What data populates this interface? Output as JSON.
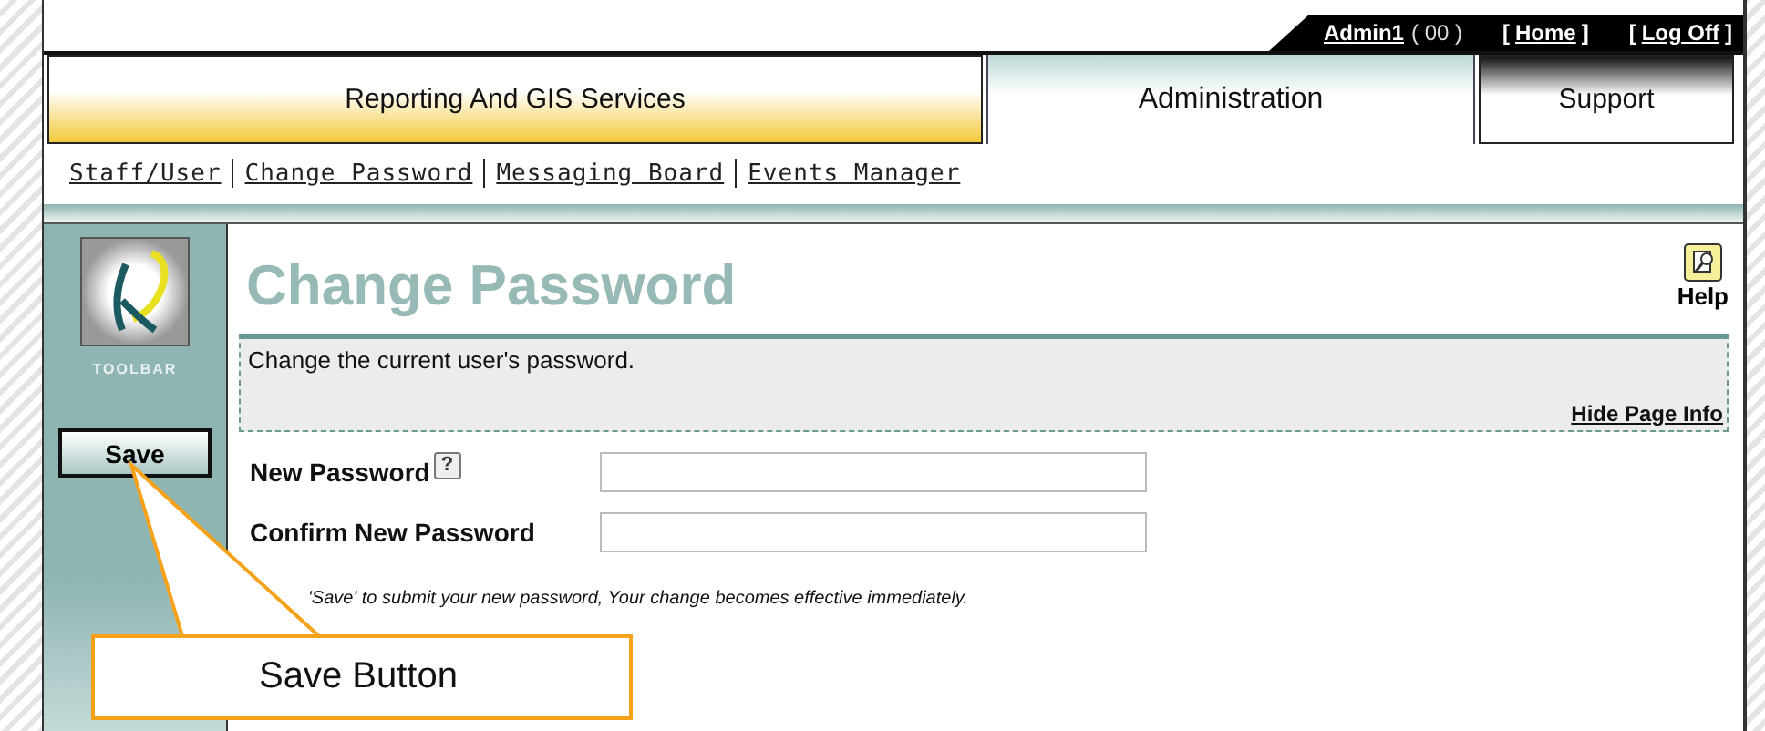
{
  "user_bar": {
    "user": "Admin1",
    "count": "( 00 )",
    "links": [
      {
        "open": "[",
        "label": "Home",
        "close": "]"
      },
      {
        "open": "[",
        "label": "Log Off",
        "close": "]"
      }
    ]
  },
  "tabs": [
    {
      "label": "Reporting And GIS Services",
      "kind": "gold",
      "selected": false
    },
    {
      "label": "Administration",
      "kind": "plain",
      "selected": true
    },
    {
      "label": "Support",
      "kind": "dark",
      "selected": false
    }
  ],
  "subnav": [
    "Staff/User",
    "Change Password",
    "Messaging Board",
    "Events Manager"
  ],
  "toolbar": {
    "caption": "TOOLBAR",
    "buttons": [
      "Save"
    ]
  },
  "page": {
    "title": "Change Password",
    "help": "Help",
    "info": "Change the current user's password.",
    "hide_info": "Hide Page Info",
    "fields": [
      {
        "label": "New Password",
        "help_mark": "?"
      },
      {
        "label": "Confirm New Password"
      }
    ],
    "note": "'Save' to submit your new password, Your change becomes effective immediately."
  },
  "callout": {
    "text": "Save Button"
  }
}
